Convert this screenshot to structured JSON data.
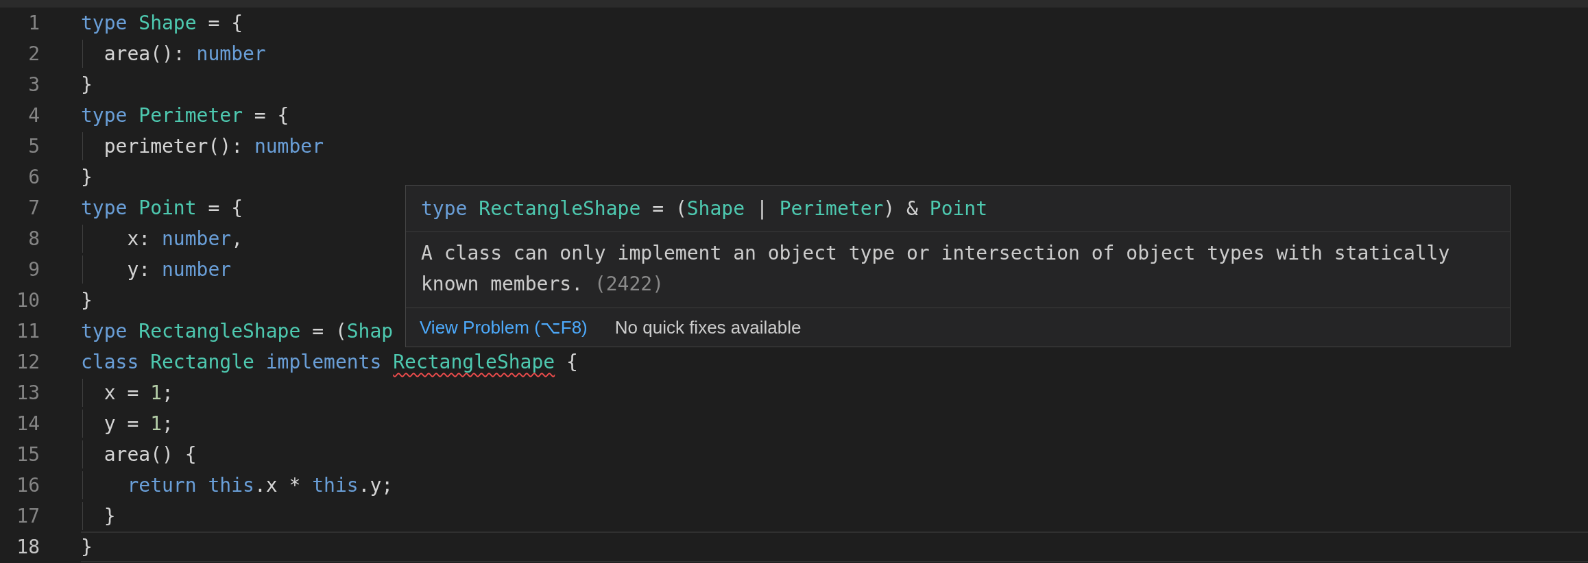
{
  "editor": {
    "lines": [
      {
        "number": "1",
        "current": false,
        "tokens": [
          {
            "text": "type ",
            "kind": "keyword"
          },
          {
            "text": "Shape",
            "kind": "type"
          },
          {
            "text": " = {",
            "kind": "plain"
          }
        ]
      },
      {
        "number": "2",
        "current": false,
        "tokens": [
          {
            "text": "  area(): ",
            "kind": "plain"
          },
          {
            "text": "number",
            "kind": "keyword"
          }
        ]
      },
      {
        "number": "3",
        "current": false,
        "tokens": [
          {
            "text": "}",
            "kind": "plain"
          }
        ]
      },
      {
        "number": "4",
        "current": false,
        "tokens": [
          {
            "text": "type ",
            "kind": "keyword"
          },
          {
            "text": "Perimeter",
            "kind": "type"
          },
          {
            "text": " = {",
            "kind": "plain"
          }
        ]
      },
      {
        "number": "5",
        "current": false,
        "tokens": [
          {
            "text": "  perimeter(): ",
            "kind": "plain"
          },
          {
            "text": "number",
            "kind": "keyword"
          }
        ]
      },
      {
        "number": "6",
        "current": false,
        "tokens": [
          {
            "text": "}",
            "kind": "plain"
          }
        ]
      },
      {
        "number": "7",
        "current": false,
        "tokens": [
          {
            "text": "type ",
            "kind": "keyword"
          },
          {
            "text": "Point",
            "kind": "type"
          },
          {
            "text": " = {",
            "kind": "plain"
          }
        ]
      },
      {
        "number": "8",
        "current": false,
        "tokens": [
          {
            "text": "    x: ",
            "kind": "plain"
          },
          {
            "text": "number",
            "kind": "keyword"
          },
          {
            "text": ",",
            "kind": "plain"
          }
        ]
      },
      {
        "number": "9",
        "current": false,
        "tokens": [
          {
            "text": "    y: ",
            "kind": "plain"
          },
          {
            "text": "number",
            "kind": "keyword"
          }
        ]
      },
      {
        "number": "10",
        "current": false,
        "tokens": [
          {
            "text": "}",
            "kind": "plain"
          }
        ]
      },
      {
        "number": "11",
        "current": false,
        "tokens": [
          {
            "text": "type ",
            "kind": "keyword"
          },
          {
            "text": "RectangleShape",
            "kind": "type"
          },
          {
            "text": " = (",
            "kind": "plain"
          },
          {
            "text": "Shap",
            "kind": "type"
          }
        ]
      },
      {
        "number": "12",
        "current": false,
        "tokens": [
          {
            "text": "class ",
            "kind": "keyword"
          },
          {
            "text": "Rectangle ",
            "kind": "type"
          },
          {
            "text": "implements ",
            "kind": "keyword"
          },
          {
            "text": "RectangleShape",
            "kind": "error"
          },
          {
            "text": " {",
            "kind": "plain"
          }
        ]
      },
      {
        "number": "13",
        "current": false,
        "tokens": [
          {
            "text": "  x = ",
            "kind": "plain"
          },
          {
            "text": "1",
            "kind": "number"
          },
          {
            "text": ";",
            "kind": "plain"
          }
        ]
      },
      {
        "number": "14",
        "current": false,
        "tokens": [
          {
            "text": "  y = ",
            "kind": "plain"
          },
          {
            "text": "1",
            "kind": "number"
          },
          {
            "text": ";",
            "kind": "plain"
          }
        ]
      },
      {
        "number": "15",
        "current": false,
        "tokens": [
          {
            "text": "  area() {",
            "kind": "plain"
          }
        ]
      },
      {
        "number": "16",
        "current": false,
        "tokens": [
          {
            "text": "    return this",
            "kind": "keyword"
          },
          {
            "text": ".x * ",
            "kind": "plain"
          },
          {
            "text": "this",
            "kind": "keyword"
          },
          {
            "text": ".y;",
            "kind": "plain"
          }
        ]
      },
      {
        "number": "17",
        "current": false,
        "tokens": [
          {
            "text": "  }",
            "kind": "plain"
          }
        ]
      },
      {
        "number": "18",
        "current": true,
        "tokens": [
          {
            "text": "}",
            "kind": "plain"
          }
        ]
      }
    ]
  },
  "hover": {
    "signature": [
      {
        "text": "type ",
        "kind": "keyword"
      },
      {
        "text": "RectangleShape",
        "kind": "type"
      },
      {
        "text": " = (",
        "kind": "plain"
      },
      {
        "text": "Shape",
        "kind": "type"
      },
      {
        "text": " | ",
        "kind": "plain"
      },
      {
        "text": "Perimeter",
        "kind": "type"
      },
      {
        "text": ") & ",
        "kind": "plain"
      },
      {
        "text": "Point",
        "kind": "type"
      }
    ],
    "message": "A class can only implement an object type or intersection of object types with statically known members.",
    "code": "(2422)",
    "actions": [
      {
        "label": "View Problem (⌥F8)",
        "kind": "link"
      },
      {
        "label": "No quick fixes available",
        "kind": "note"
      }
    ]
  }
}
